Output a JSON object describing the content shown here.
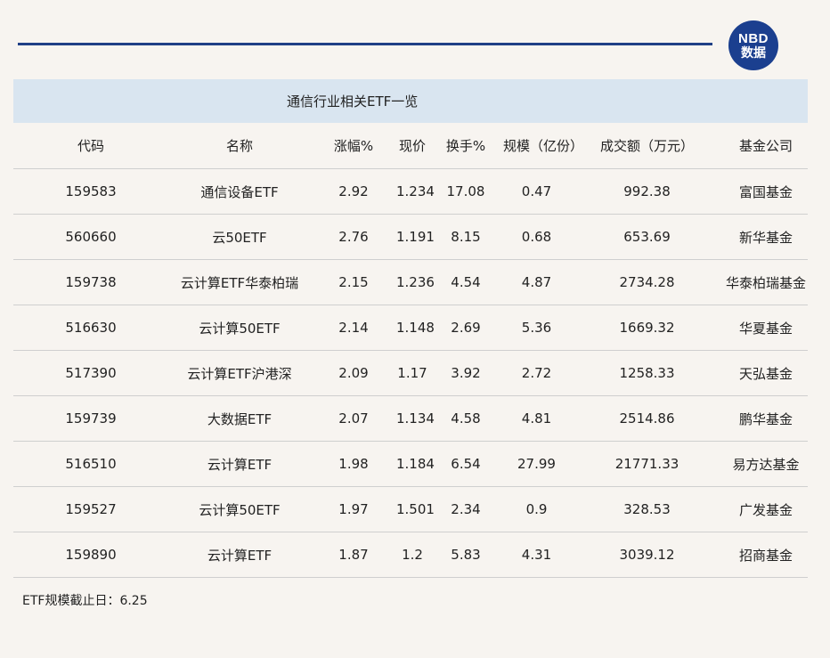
{
  "brand": {
    "logo_top": "NBD",
    "logo_bottom": "数据"
  },
  "table": {
    "title": "通信行业相关ETF一览",
    "headers": [
      "代码",
      "名称",
      "涨幅%",
      "现价",
      "换手%",
      "规模（亿份）",
      "成交额（万元）",
      "基金公司"
    ],
    "rows": [
      [
        "159583",
        "通信设备ETF",
        "2.92",
        "1.234",
        "17.08",
        "0.47",
        "992.38",
        "富国基金"
      ],
      [
        "560660",
        "云50ETF",
        "2.76",
        "1.191",
        "8.15",
        "0.68",
        "653.69",
        "新华基金"
      ],
      [
        "159738",
        "云计算ETF华泰柏瑞",
        "2.15",
        "1.236",
        "4.54",
        "4.87",
        "2734.28",
        "华泰柏瑞基金"
      ],
      [
        "516630",
        "云计算50ETF",
        "2.14",
        "1.148",
        "2.69",
        "5.36",
        "1669.32",
        "华夏基金"
      ],
      [
        "517390",
        "云计算ETF沪港深",
        "2.09",
        "1.17",
        "3.92",
        "2.72",
        "1258.33",
        "天弘基金"
      ],
      [
        "159739",
        "大数据ETF",
        "2.07",
        "1.134",
        "4.58",
        "4.81",
        "2514.86",
        "鹏华基金"
      ],
      [
        "516510",
        "云计算ETF",
        "1.98",
        "1.184",
        "6.54",
        "27.99",
        "21771.33",
        "易方达基金"
      ],
      [
        "159527",
        "云计算50ETF",
        "1.97",
        "1.501",
        "2.34",
        "0.9",
        "328.53",
        "广发基金"
      ],
      [
        "159890",
        "云计算ETF",
        "1.87",
        "1.2",
        "5.83",
        "4.31",
        "3039.12",
        "招商基金"
      ]
    ]
  },
  "footnote": "ETF规模截止日：6.25",
  "colors": {
    "accent": "#1f3f86",
    "title_bg": "#d9e5f0",
    "page_bg": "#f7f4f0"
  }
}
